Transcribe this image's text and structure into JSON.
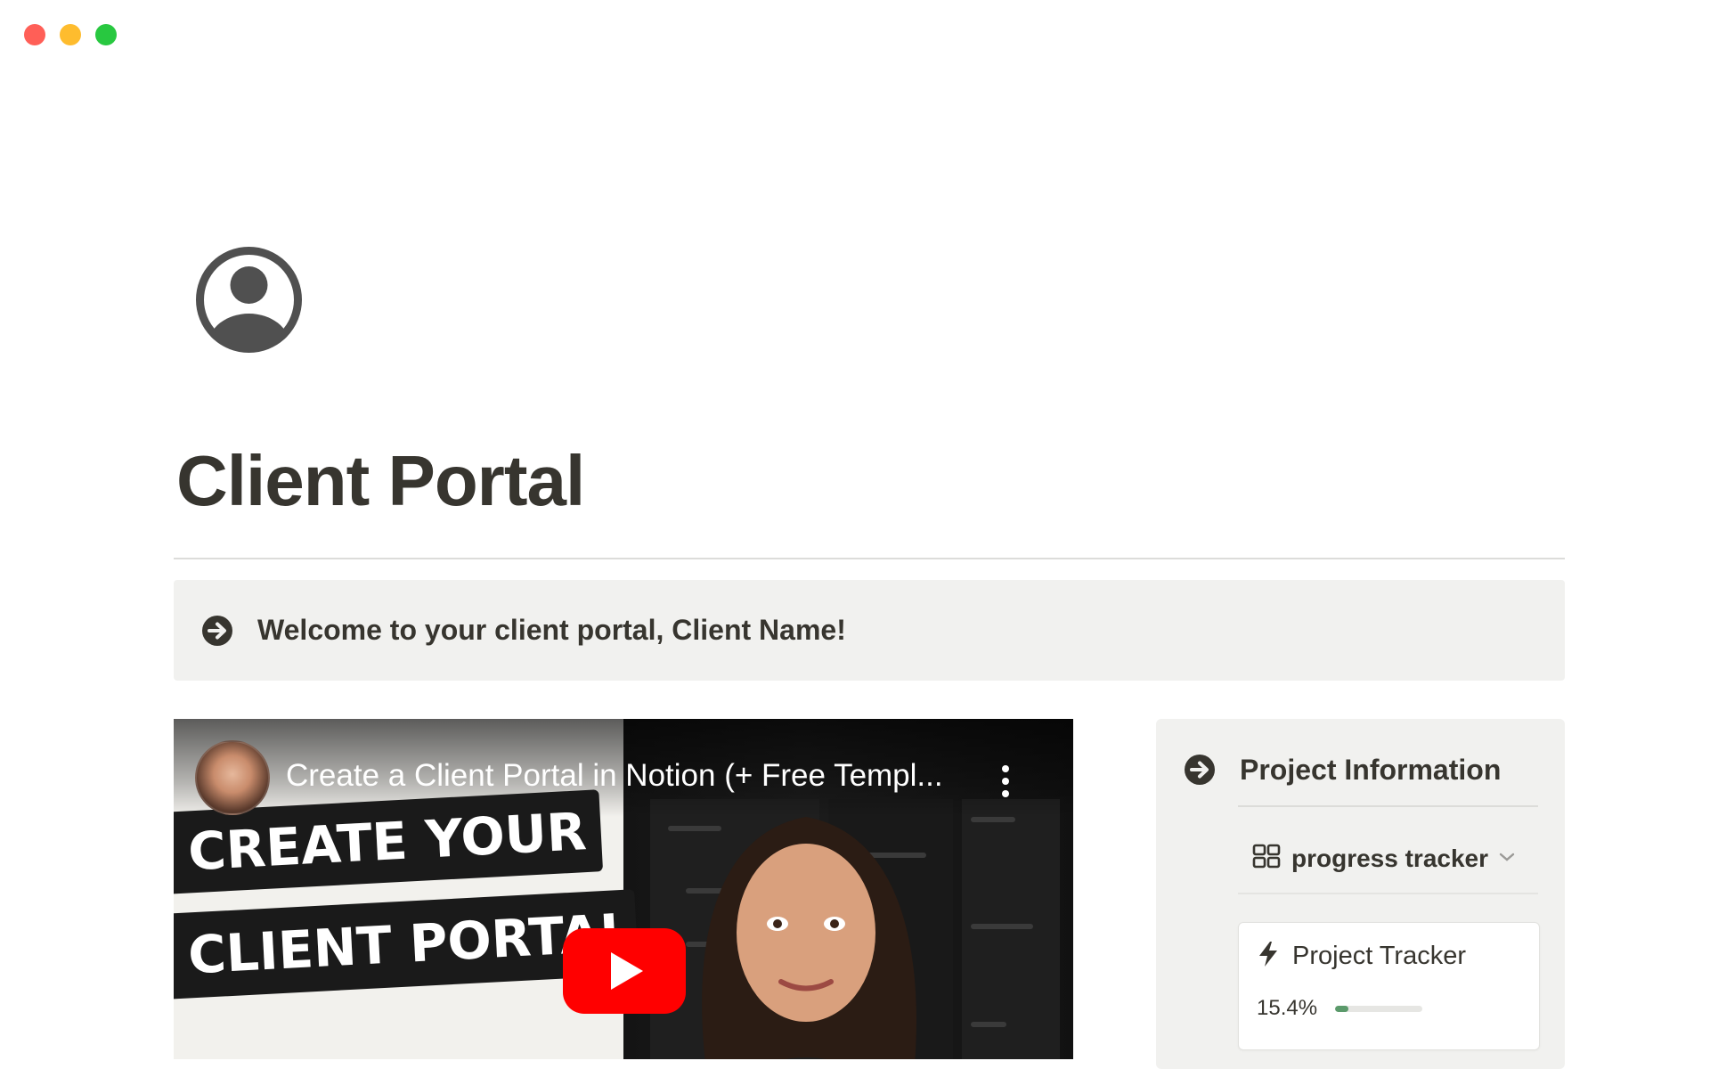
{
  "window": {
    "traffic_lights": [
      {
        "name": "close",
        "color": "#ff5f57"
      },
      {
        "name": "minimize",
        "color": "#febc2e"
      },
      {
        "name": "zoom",
        "color": "#28c840"
      }
    ]
  },
  "page": {
    "icon": "user-circle-icon",
    "title": "Client Portal"
  },
  "callout": {
    "icon": "arrow-circle-right-icon",
    "text": "Welcome to your client portal, Client Name!"
  },
  "video": {
    "title": "Create a Client Portal in Notion (+ Free Templ...",
    "thumbnail_line1": "CREATE YOUR",
    "thumbnail_line2": "CLIENT PORTAL",
    "play_color": "#ff0000"
  },
  "project_info": {
    "icon": "arrow-circle-right-icon",
    "title": "Project Information",
    "view": {
      "icon": "gallery-grid-icon",
      "label": "progress tracker",
      "chevron": "chevron-down-icon"
    },
    "card": {
      "icon": "lightning-icon",
      "name": "Project Tracker",
      "progress_label": "15.4%",
      "progress": 0.154,
      "progress_color": "#5b9a6b"
    }
  }
}
